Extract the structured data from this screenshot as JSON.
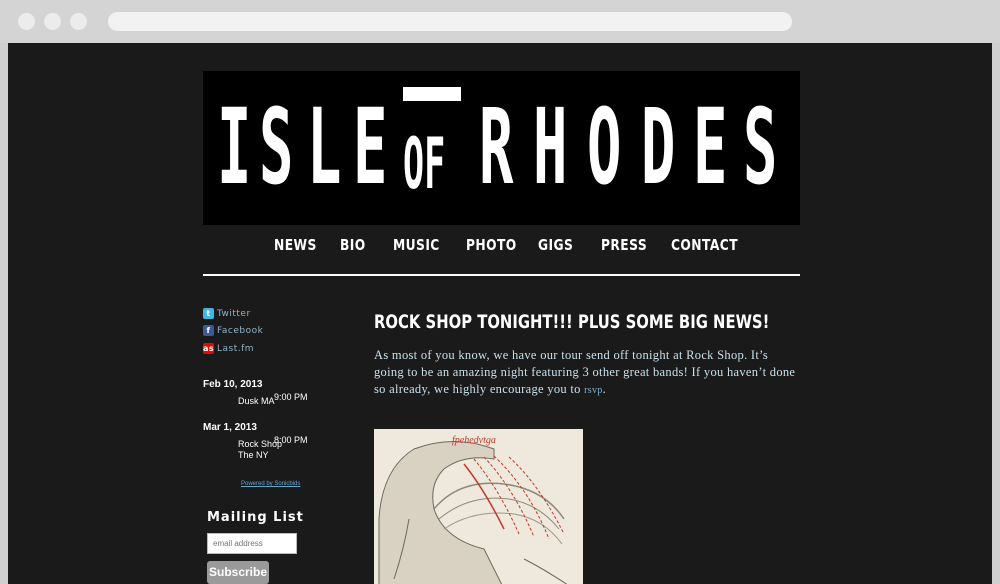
{
  "band": {
    "letters_left": [
      "I",
      "S",
      "L",
      "E"
    ],
    "of": "OF",
    "letters_right": [
      "R",
      "H",
      "O",
      "D",
      "E",
      "S"
    ],
    "name": "ISLE OF RHODES"
  },
  "nav": [
    "NEWS",
    "BIO",
    "MUSIC",
    "PHOTO",
    "GIGS",
    "PRESS",
    "CONTACT"
  ],
  "social": [
    {
      "label": "Twitter",
      "icon": "twitter-icon",
      "color": "#3fb7e6"
    },
    {
      "label": "Facebook",
      "icon": "facebook-icon",
      "color": "#3b5998"
    },
    {
      "label": "Last.fm",
      "icon": "lastfm-icon",
      "color": "#d51007"
    }
  ],
  "gigs": [
    {
      "date": "Feb 10, 2013",
      "time": "9:00 PM",
      "venue": "Dusk MA"
    },
    {
      "date": "Mar 1, 2013",
      "time": "8:00 PM",
      "venue": "Rock Shop The NY"
    }
  ],
  "powered_by": "Powered by Sonicbids",
  "mailing": {
    "title": "Mailing List",
    "placeholder": "email address",
    "button": "Subscribe"
  },
  "post": {
    "title": "ROCK SHOP TONIGHT!!! PLUS SOME BIG NEWS!",
    "body": "As most of you know, we have our tour send off tonight at Rock Shop. It’s going to be an amazing night featuring 3 other great bands! If you haven’t done so already, we highly encourage you to ",
    "link": "rsvp",
    "end": ".",
    "image_caption": "fpehedvtga"
  },
  "colors": {
    "page_bg": "#1a1a1a",
    "banner_bg": "#000000",
    "link": "#8fb4c9",
    "body_text": "#c9e0ec"
  }
}
